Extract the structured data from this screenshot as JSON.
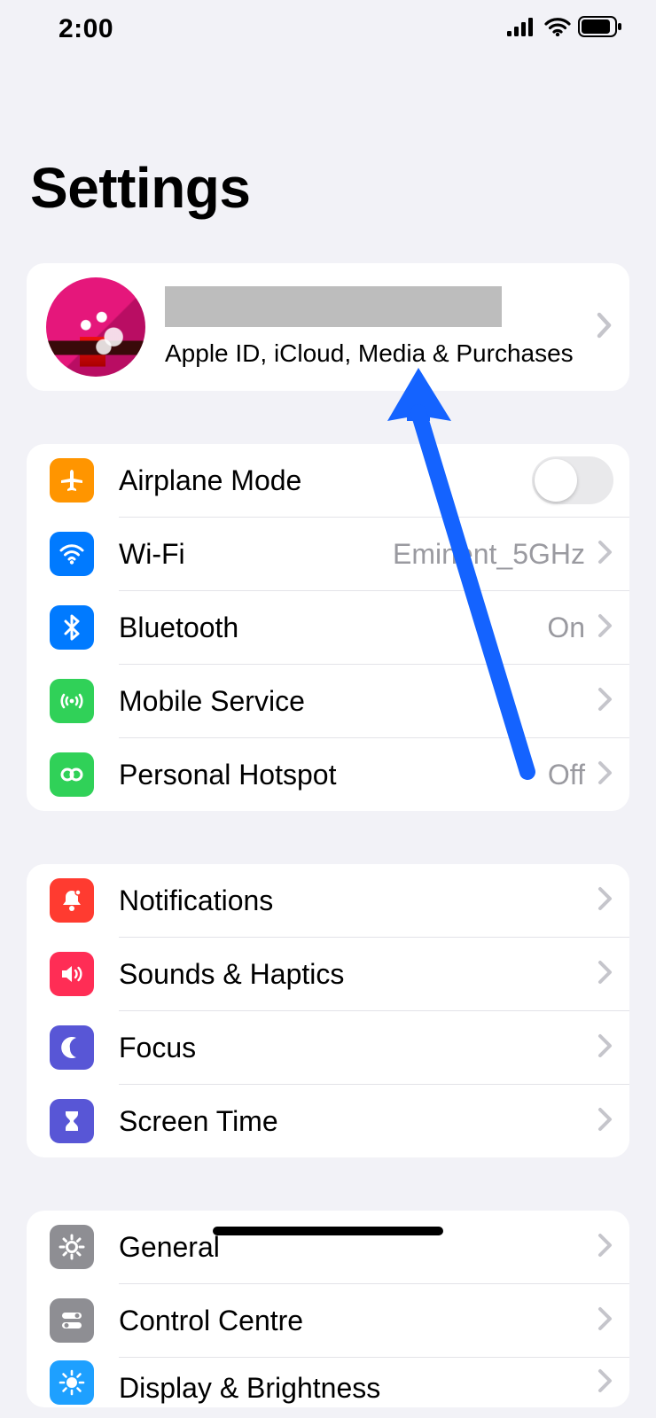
{
  "status": {
    "time": "2:00"
  },
  "title": "Settings",
  "profile": {
    "subtitle": "Apple ID, iCloud, Media & Purchases"
  },
  "group1": {
    "airplane": {
      "label": "Airplane Mode",
      "on": false
    },
    "wifi": {
      "label": "Wi-Fi",
      "value": "Eminent_5GHz"
    },
    "bluetooth": {
      "label": "Bluetooth",
      "value": "On"
    },
    "mobile": {
      "label": "Mobile Service"
    },
    "hotspot": {
      "label": "Personal Hotspot",
      "value": "Off"
    }
  },
  "group2": {
    "notifications": {
      "label": "Notifications"
    },
    "sounds": {
      "label": "Sounds & Haptics"
    },
    "focus": {
      "label": "Focus"
    },
    "screentime": {
      "label": "Screen Time"
    }
  },
  "group3": {
    "general": {
      "label": "General"
    },
    "controlcentre": {
      "label": "Control Centre"
    },
    "display": {
      "label": "Display & Brightness"
    }
  }
}
